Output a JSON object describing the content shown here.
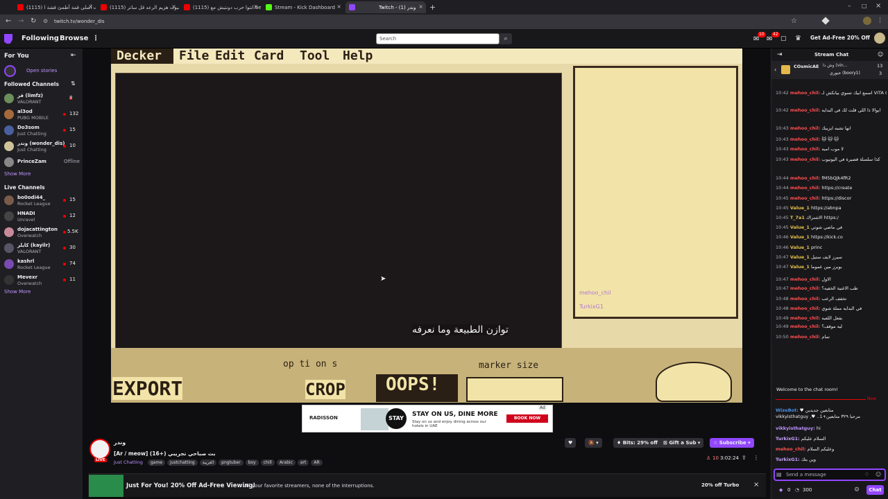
{
  "browser": {
    "tabs": [
      {
        "title": "(1115) حلويات أصلي قمة أطمئ قشة ا..",
        "active": false
      },
      {
        "title": "(1115) البوت هزيم الرعد قل ساتر..",
        "active": false
      },
      {
        "title": "(1115) انتوا حرب دونتيش مع.be..",
        "active": false
      },
      {
        "title": "Stream - Kick Dashboard",
        "active": false
      },
      {
        "title": "Twitch - وندر (1)",
        "active": true
      }
    ],
    "url": "twitch.tv/wonder_dis"
  },
  "topnav": {
    "following": "Following",
    "browse": "Browse",
    "more": "⋮",
    "search_placeholder": "Search",
    "notif_count_1": "10",
    "notif_count_2": "42",
    "adfree": "Get Ad-Free 20% Off"
  },
  "sidebar": {
    "for_you": "For You",
    "open_stories": "Open stories",
    "followed_heading": "Followed Channels",
    "followed": [
      {
        "name": "قز (limfz)",
        "game": "VALORANT",
        "viewers": "8",
        "color": "#6b8e5a"
      },
      {
        "name": "al3od",
        "game": "PUBG MOBILE",
        "viewers": "132",
        "color": "#a56a3a"
      },
      {
        "name": "Do3som",
        "game": "Just Chatting",
        "viewers": "15",
        "color": "#4a5fa0"
      },
      {
        "name": "وندر (wonder_dis)",
        "game": "Just Chatting",
        "viewers": "10",
        "color": "#cfc39a"
      },
      {
        "name": "PrinceZam",
        "game": "",
        "viewers": "Offline",
        "color": "#888"
      }
    ],
    "show_more_1": "Show More",
    "live_heading": "Live Channels",
    "live": [
      {
        "name": "bo0odi44_",
        "game": "Rocket League",
        "viewers": "15",
        "color": "#7a5b4a"
      },
      {
        "name": "HNADI",
        "game": "Unravel",
        "viewers": "12",
        "color": "#444"
      },
      {
        "name": "dojacattington",
        "game": "Overwatch",
        "viewers": "5.5K",
        "color": "#c88a9a"
      },
      {
        "name": "كايلر (kayilr)",
        "game": "VALORANT",
        "viewers": "30",
        "color": "#556"
      },
      {
        "name": "kashrl",
        "game": "Rocket League",
        "viewers": "74",
        "color": "#7a4ab0"
      },
      {
        "name": "Mevexr",
        "game": "Overwatch",
        "viewers": "11",
        "color": "#333"
      }
    ],
    "show_more_2": "Show More"
  },
  "video": {
    "menu": [
      "Decker",
      "File",
      "Edit",
      "Card",
      "Tool",
      "Help"
    ],
    "subtitle": "توازن الطبيعة وما نعرفه",
    "options": "op ti on s",
    "export": "EXPORT",
    "crop": "CROP",
    "oops": "OOPS!",
    "marker": "marker size",
    "panel_user1": "mehoo_chil",
    "panel_user2": "TurkixG1"
  },
  "ad": {
    "brand": "RADISSON",
    "stay": "STAY",
    "headline": "STAY ON US, DINE MORE",
    "sub": "Stay on us and enjoy dining across our hotels in UAE",
    "cta": "BOOK NOW",
    "badge": "Ad"
  },
  "stream": {
    "channel": "وندر",
    "title": "[Ar / meow] (16+) بث صباحي تجريبي",
    "live": "LIVE",
    "category": "Just Chatting",
    "tags": [
      "game",
      "justchatting",
      "العربية",
      "pngtuber",
      "boy",
      "chill",
      "Arabic",
      "art",
      "AR"
    ],
    "viewers": "10",
    "uptime": "3:02:24",
    "bits": "Bits: 29% off",
    "gift": "Gift a Sub",
    "subscribe": "Subscribe"
  },
  "promo": {
    "headline": "Just For You! 20% Off Ad-Free Viewing!",
    "sub": "All your favorite streamers, none of the interruptions.",
    "turbo": "20% off Turbo"
  },
  "chat": {
    "header": "Stream Chat",
    "pinned_user": "COsmicAE",
    "pinned_text": "وش ذا (vin...",
    "pinned_count1": "13",
    "pinned_user2": "جيوري (boory1)",
    "pinned_count2": "3",
    "messages": [
      {
        "time": "10:42",
        "user": "mehoo_chil:",
        "text": "اسمع ابيك تسوي بيانكش لـ VITA CARNIS"
      },
      {
        "time": "10:42",
        "user": "mehoo_chil:",
        "text": "ايوالا ذا اللي قلت لك في البدايه"
      },
      {
        "time": "10:43",
        "user": "mehoo_chil:",
        "text": "انها تشبه ايزيبك"
      },
      {
        "time": "10:43",
        "user": "mehoo_chil:",
        "text": "🐱 🐱 🐱"
      },
      {
        "time": "10:43",
        "user": "mehoo_chil:",
        "text": "لا موب امبه"
      },
      {
        "time": "10:43",
        "user": "mehoo_chil:",
        "text": "كذا سلسلة قصيرة في اليوتيوب"
      },
      {
        "time": "10:44",
        "user": "mehoo_chil:",
        "text": "fM5bQJk4fR2"
      },
      {
        "time": "10:44",
        "user": "mehoo_chil:",
        "text": "https://create"
      },
      {
        "time": "10:45",
        "user": "mehoo_chil:",
        "text": "https://discor"
      },
      {
        "time": "10:45",
        "user": "Value_1",
        "text": "https://abnpa"
      },
      {
        "time": "10:45",
        "user": "T_7a1",
        "text": "الاشتراك https:/"
      },
      {
        "time": "10:45",
        "user": "Value_1",
        "text": "في ماضي شوتي"
      },
      {
        "time": "10:46",
        "user": "Value_1",
        "text": "https://kick.co"
      },
      {
        "time": "10:46",
        "user": "Value_1",
        "text": "princ"
      },
      {
        "time": "10:47",
        "user": "Value_1",
        "text": "سيرز لايف ستيل"
      },
      {
        "time": "10:47",
        "user": "Value_1",
        "text": "بوبرز مين عموما"
      },
      {
        "time": "10:47",
        "user": "mehoo_chil:",
        "text": "الاول"
      },
      {
        "time": "10:47",
        "user": "mehoo_chil:",
        "text": "طب الاغنية الخفيه؟"
      },
      {
        "time": "10:48",
        "user": "mehoo_chil:",
        "text": "تخفف الرعب"
      },
      {
        "time": "10:48",
        "user": "mehoo_chil:",
        "text": "في البدايه مملة شوي"
      },
      {
        "time": "10:49",
        "user": "mehoo_chil:",
        "text": "بفعل اللعبه"
      },
      {
        "time": "10:49",
        "user": "mehoo_chil:",
        "text": "ليه موقف؟"
      },
      {
        "time": "10:50",
        "user": "mehoo_chil:",
        "text": "تمام"
      }
    ],
    "welcome": "Welcome to the chat room!",
    "new_label": "New",
    "recent": [
      {
        "user": "WizeBot:",
        "text": "♥ متابعين جديدين"
      },
      {
        "user": "",
        "text": "vikkyisthatguy ,♥ ..مرحبا ٣٢٩ متابعين+1"
      },
      {
        "user": "vikkyisthatguy:",
        "text": "hi"
      },
      {
        "user": "TurkixG1:",
        "text": "السلام عليكم"
      },
      {
        "user": "mehoo_chil:",
        "text": "وعليكم السلام"
      },
      {
        "user": "TurkixG1:",
        "text": "وين بتك"
      }
    ],
    "input_placeholder": "Send a message",
    "points": "0",
    "points2": "300",
    "chat_btn": "Chat"
  }
}
